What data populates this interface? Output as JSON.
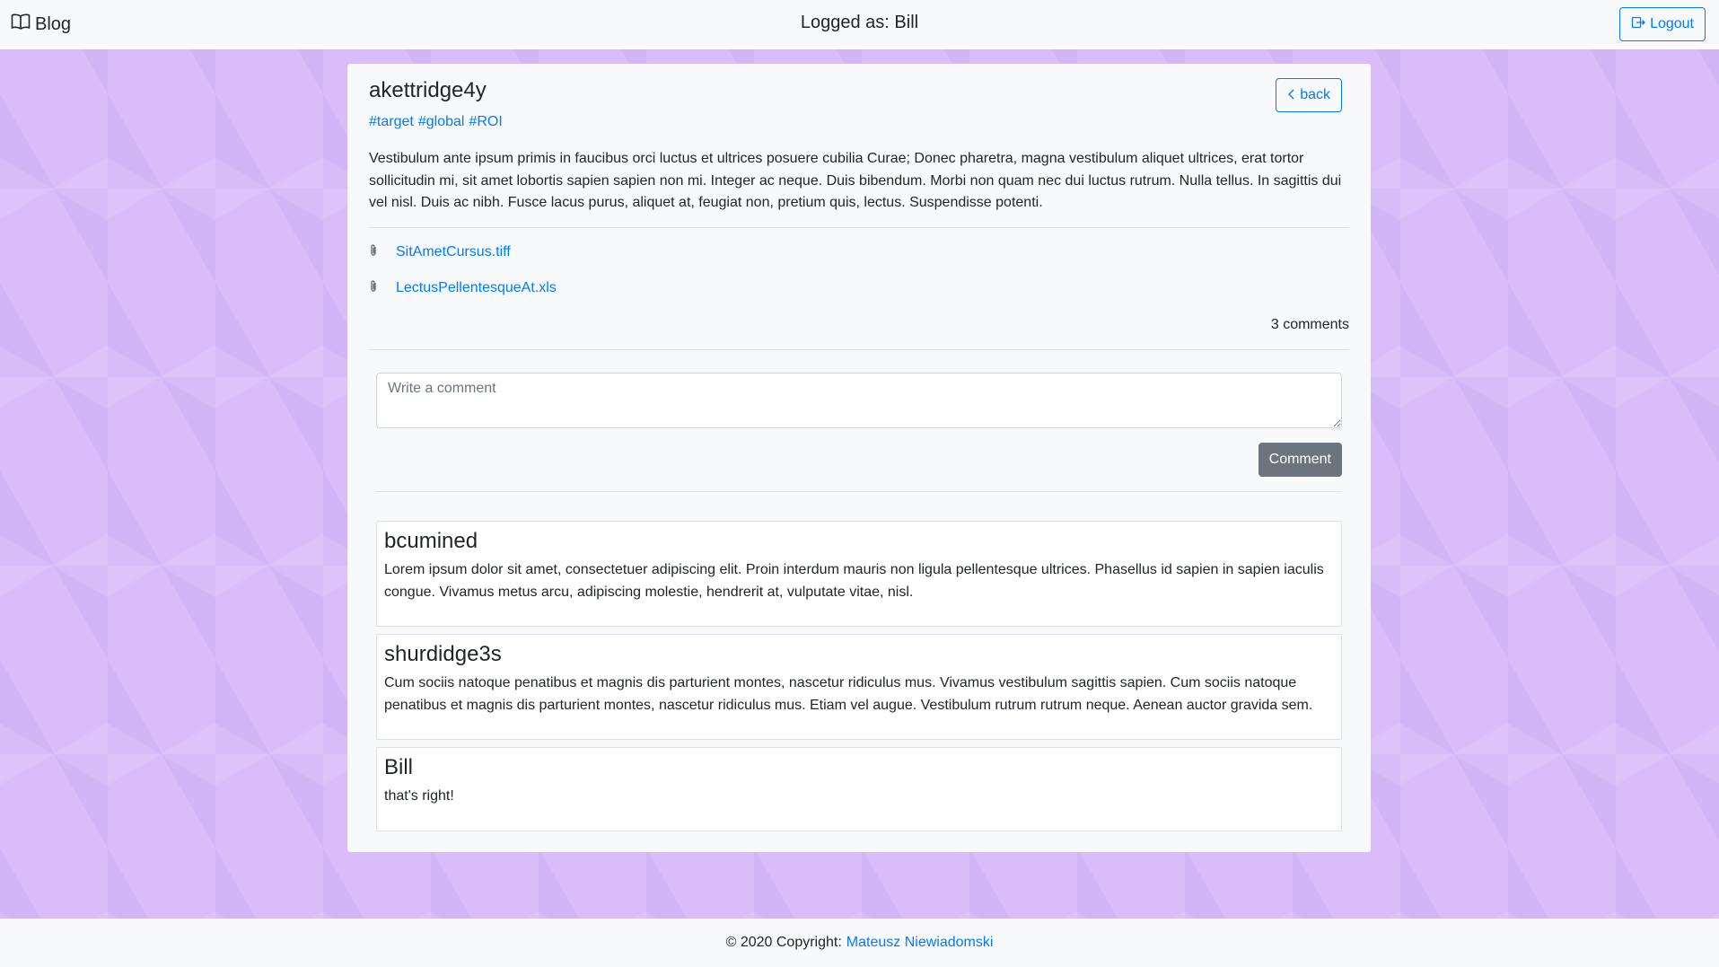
{
  "navbar": {
    "brand_label": "Blog",
    "brand_icon": "book-icon",
    "logged_text": "Logged as: Bill",
    "logout_label": "Logout",
    "logout_icon": "logout-icon"
  },
  "post": {
    "title": "akettridge4y",
    "back_label": "back",
    "tags": [
      "#target",
      "#global",
      "#ROI"
    ],
    "body": "Vestibulum ante ipsum primis in faucibus orci luctus et ultrices posuere cubilia Curae; Donec pharetra, magna vestibulum aliquet ultrices, erat tortor sollicitudin mi, sit amet lobortis sapien sapien non mi. Integer ac neque. Duis bibendum. Morbi non quam nec dui luctus rutrum. Nulla tellus. In sagittis dui vel nisl. Duis ac nibh. Fusce lacus purus, aliquet at, feugiat non, pretium quis, lectus. Suspendisse potenti.",
    "attachments": [
      "SitAmetCursus.tiff",
      "LectusPellentesqueAt.xls"
    ],
    "comment_count": "3 comments"
  },
  "comment_form": {
    "placeholder": "Write a comment",
    "value": "",
    "submit_label": "Comment"
  },
  "comments": [
    {
      "author": "bcumined",
      "text": "Lorem ipsum dolor sit amet, consectetuer adipiscing elit. Proin interdum mauris non ligula pellentesque ultrices. Phasellus id sapien in sapien iaculis congue. Vivamus metus arcu, adipiscing molestie, hendrerit at, vulputate vitae, nisl."
    },
    {
      "author": "shurdidge3s",
      "text": "Cum sociis natoque penatibus et magnis dis parturient montes, nascetur ridiculus mus. Vivamus vestibulum sagittis sapien. Cum sociis natoque penatibus et magnis dis parturient montes, nascetur ridiculus mus. Etiam vel augue. Vestibulum rutrum rutrum neque. Aenean auctor gravida sem."
    },
    {
      "author": "Bill",
      "text": "that's right!"
    }
  ],
  "footer": {
    "copyright": "© 2020 Copyright:",
    "author_link": "Mateusz Niewiadomski"
  },
  "colors": {
    "background": "#d9bcf9",
    "link": "#007bff",
    "secondary_button": "#6c757d"
  }
}
